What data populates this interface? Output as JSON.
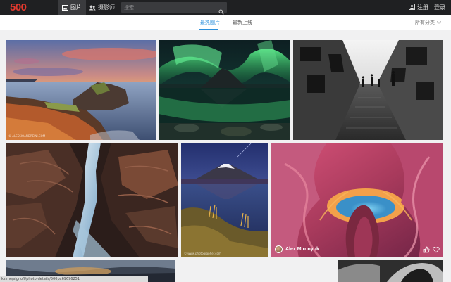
{
  "header": {
    "logo": "500",
    "nav_photos": "图片",
    "nav_photographers": "摄影师",
    "search_placeholder": "搜索",
    "register": "注册",
    "login": "登录"
  },
  "subnav": {
    "tabs": [
      {
        "label": "最热图片",
        "active": true
      },
      {
        "label": "最新上线",
        "active": false
      }
    ],
    "category": "所有分类"
  },
  "photos": [
    {
      "subject": "sunset sea cliff",
      "watermark": "© ALESSIOANDREINI.COM"
    },
    {
      "subject": "aurora over mountain"
    },
    {
      "subject": "black and white street"
    },
    {
      "subject": "canyon waterfall"
    },
    {
      "subject": "volcano lake sunrise",
      "watermark": "© www.photographer.com"
    },
    {
      "subject": "antelope canyon",
      "credit": "Alex Mironyuk"
    },
    {
      "subject": "desert dusk"
    },
    {
      "subject": "monochrome arch"
    }
  ],
  "status_url": "ks.me/signoff/photo-details/500px69696251",
  "colors": {
    "accent": "#2a8fdc",
    "brand": "#e2392e",
    "topbar": "#1f2022"
  }
}
